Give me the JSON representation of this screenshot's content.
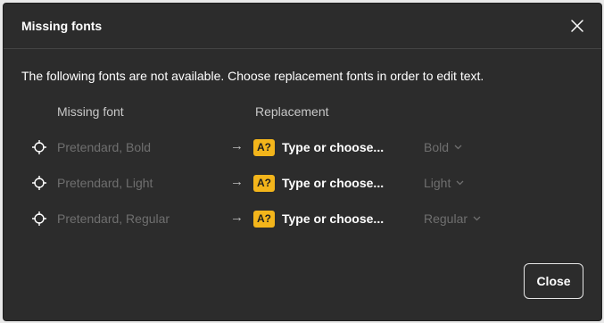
{
  "dialog": {
    "title": "Missing fonts",
    "description": "The following fonts are not available. Choose replacement fonts in order to edit text.",
    "close_label": "Close"
  },
  "columns": {
    "missing": "Missing font",
    "replacement": "Replacement"
  },
  "rows": [
    {
      "missing_font": "Pretendard, Bold",
      "arrow": "→",
      "badge": "A?",
      "replacement_placeholder": "Type or choose...",
      "style": "Bold"
    },
    {
      "missing_font": "Pretendard, Light",
      "arrow": "→",
      "badge": "A?",
      "replacement_placeholder": "Type or choose...",
      "style": "Light"
    },
    {
      "missing_font": "Pretendard, Regular",
      "arrow": "→",
      "badge": "A?",
      "replacement_placeholder": "Type or choose...",
      "style": "Regular"
    }
  ],
  "colors": {
    "dialog_bg": "#2c2c2c",
    "warning_badge": "#f3b51b",
    "muted_text": "#6f6f6f"
  },
  "icons": {
    "row_locate": "crosshair-icon",
    "close": "close-icon",
    "dropdown": "chevron-down-icon"
  }
}
